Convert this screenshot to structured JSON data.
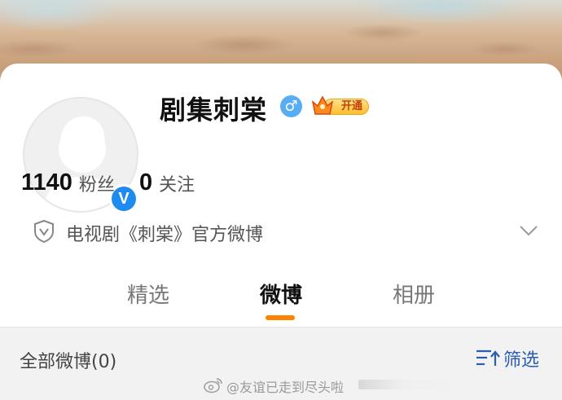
{
  "banner": {
    "icon": "beach-sand-banner"
  },
  "profile": {
    "name": "剧集刺棠",
    "verified_icon": "v-verified-icon",
    "verified_glyph": "V",
    "gender_icon": "male-icon",
    "gender_glyph": "♂",
    "vip_label": "开通",
    "vip_icon": "crown-icon"
  },
  "stats": {
    "followers_count": "1140",
    "followers_label": "粉丝",
    "following_count": "0",
    "following_label": "关注"
  },
  "description": {
    "icon": "shield-icon",
    "text": "电视剧《刺棠》官方微博",
    "expand_icon": "chevron-down-icon"
  },
  "tabs": [
    {
      "label": "精选",
      "active": false
    },
    {
      "label": "微博",
      "active": true
    },
    {
      "label": "相册",
      "active": false
    }
  ],
  "feed_filter": {
    "all_label": "全部微博(0)",
    "filter_label": "筛选",
    "filter_icon": "filter-sort-icon"
  },
  "footer": {
    "watermark_text": "@友谊已走到尽头啦",
    "icon": "weibo-logo-icon"
  },
  "colors": {
    "accent": "#ff8200",
    "verified_blue": "#1f8bf0",
    "link_blue": "#2a5db0",
    "gender_blue": "#58aef5"
  }
}
